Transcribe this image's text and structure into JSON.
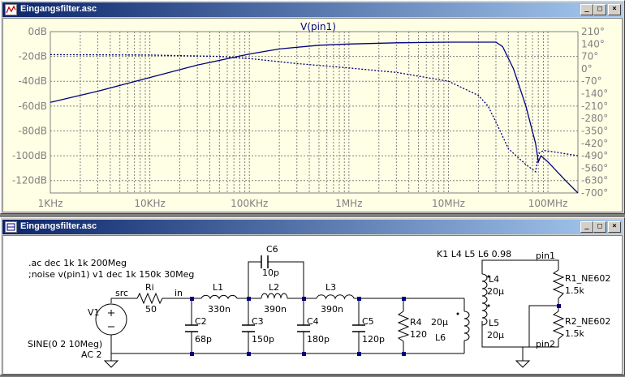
{
  "plot_window": {
    "title": "Eingangsfilter.asc",
    "buttons": {
      "minimize": "_",
      "maximize": "□",
      "close": "×"
    },
    "trace_label": "V(pin1)",
    "colors": {
      "trace": "#00007f",
      "grid": "#808080",
      "label": "#808080",
      "background": "#ffffe6"
    }
  },
  "schematic_window": {
    "title": "Eingangsfilter.asc",
    "buttons": {
      "minimize": "_",
      "maximize": "□",
      "close": "×"
    },
    "directives": [
      ".ac dec 1k 1k 200Meg",
      ";noise v(pin1) v1 dec 1k 150k 30Meg"
    ],
    "coupling": "K1 L4 L5 L6 0.98",
    "source": {
      "name": "V1",
      "value1": "SINE(0 2 10Meg)",
      "value2": "AC 2"
    },
    "nets": {
      "src": "src",
      "in": "in",
      "pin1": "pin1",
      "pin2": "pin2"
    },
    "components": {
      "Ri": {
        "name": "Ri",
        "value": "50"
      },
      "L1": {
        "name": "L1",
        "value": "330n"
      },
      "L2": {
        "name": "L2",
        "value": "390n"
      },
      "L3": {
        "name": "L3",
        "value": "390n"
      },
      "C2": {
        "name": "C2",
        "value": "68p"
      },
      "C3": {
        "name": "C3",
        "value": "150p"
      },
      "C4": {
        "name": "C4",
        "value": "180p"
      },
      "C5": {
        "name": "C5",
        "value": "120p"
      },
      "C6": {
        "name": "C6",
        "value": "10p"
      },
      "R4": {
        "name": "R4",
        "value": "120"
      },
      "L4": {
        "name": "L4",
        "value": "20µ"
      },
      "L5": {
        "name": "L5",
        "value": "20µ"
      },
      "L6": {
        "name": "L6",
        "value": "20µ"
      },
      "R1": {
        "name": "R1_NE602",
        "value": "1.5k"
      },
      "R2": {
        "name": "R2_NE602",
        "value": "1.5k"
      }
    }
  },
  "chart_data": {
    "type": "line",
    "title": "V(pin1)",
    "x_scale": "log",
    "xlim": [
      1000,
      200000000
    ],
    "x_ticks": [
      "1KHz",
      "10KHz",
      "100KHz",
      "1MHz",
      "10MHz",
      "100MHz"
    ],
    "ylim_left": [
      -120,
      10
    ],
    "y_ticks_left": [
      "0dB",
      "-20dB",
      "-40dB",
      "-60dB",
      "-80dB",
      "-100dB",
      "-120dB"
    ],
    "ylim_right": [
      -700,
      210
    ],
    "y_ticks_right": [
      "210°",
      "140°",
      "70°",
      "0°",
      "-70°",
      "-140°",
      "-210°",
      "-280°",
      "-350°",
      "-420°",
      "-490°",
      "-560°",
      "-630°",
      "-700°"
    ],
    "grid": true,
    "series": [
      {
        "axis": "left",
        "style": "solid",
        "x": [
          1000,
          3000,
          10000,
          30000,
          100000,
          200000,
          500000,
          1000000,
          3000000,
          10000000,
          20000000,
          30000000,
          35000000,
          45000000,
          60000000,
          75000000,
          80000000,
          85000000,
          100000000,
          150000000,
          200000000
        ],
        "y": [
          -47,
          -38,
          -27,
          -17,
          -8,
          -4,
          -1,
          0,
          1,
          1.5,
          1.5,
          1.5,
          -2,
          -20,
          -50,
          -80,
          -95,
          -90,
          -95,
          -110,
          -120
        ]
      },
      {
        "axis": "right",
        "style": "dotted",
        "x": [
          1000,
          10000,
          50000,
          100000,
          300000,
          1000000,
          3000000,
          10000000,
          20000000,
          25000000,
          30000000,
          40000000,
          60000000,
          75000000,
          80000000,
          90000000,
          120000000,
          200000000
        ],
        "y": [
          80,
          78,
          70,
          58,
          30,
          5,
          -20,
          -70,
          -150,
          -210,
          -300,
          -450,
          -540,
          -580,
          -480,
          -460,
          -470,
          -490
        ]
      }
    ]
  }
}
